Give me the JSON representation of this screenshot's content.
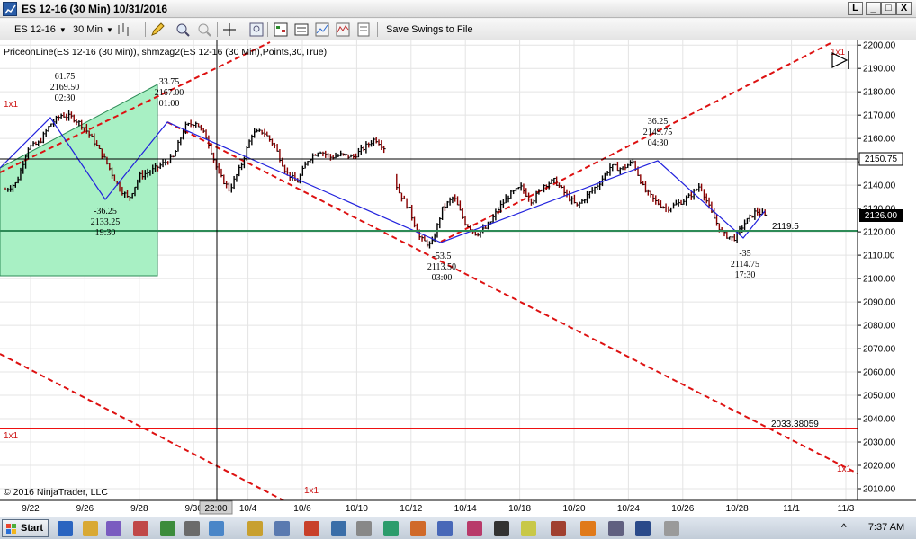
{
  "window": {
    "title": "ES 12-16 (30 Min)  10/31/2016",
    "minimize": "_",
    "maximize": "□",
    "close": "X",
    "restore": "L"
  },
  "toolbar": {
    "instrument": "ES 12-16",
    "interval": "30 Min",
    "save_swings_label": "Save Swings to File",
    "icons": [
      "bars-icon",
      "pencil-icon",
      "zoom-in-icon",
      "zoom-out-icon",
      "crosshair-icon",
      "magnifier-icon",
      "data-box-icon",
      "properties-icon",
      "chart-style-icon",
      "indicators-icon",
      "strategies-icon"
    ]
  },
  "chart": {
    "indicator_label": "PriceonLine(ES 12-16 (30 Min)), shmzag2(ES 12-16 (30 Min),Points,30,True)",
    "copyright": "© 2016 NinjaTrader, LLC",
    "cursor_time_label": "22:00",
    "line_labels": {
      "resistance_price": "2150.75",
      "support_price": "2119.5",
      "horizontal_red_price": "2033.38059",
      "last_price": "2126.00"
    },
    "gann_labels": [
      "1x1",
      "1x1",
      "1x1",
      "1x1",
      "1x1"
    ],
    "colors": {
      "swing_line": "#2222dd",
      "gann_line": "#dd1111",
      "support_line": "#2e8b57",
      "rectangle_fill": "#a8f0c4",
      "up_bar": "#000000"
    }
  },
  "chart_data": {
    "type": "bar",
    "title": "ES 12-16 (30 Min)",
    "ylim": [
      2005,
      2202
    ],
    "y_ticks": [
      "2200.00",
      "2190.00",
      "2180.00",
      "2170.00",
      "2160.00",
      "2150.00",
      "2140.00",
      "2130.00",
      "2120.00",
      "2110.00",
      "2100.00",
      "2090.00",
      "2080.00",
      "2070.00",
      "2060.00",
      "2050.00",
      "2040.00",
      "2030.00",
      "2020.00",
      "2010.00"
    ],
    "x_tick_labels": [
      "9/22",
      "9/26",
      "9/28",
      "9/30",
      "10/4",
      "10/6",
      "10/10",
      "10/12",
      "10/14",
      "10/18",
      "10/20",
      "10/24",
      "10/26",
      "10/28",
      "11/1",
      "11/3"
    ],
    "swing_points": [
      {
        "time": "02:30",
        "price": 2169.5,
        "change": "61.75",
        "type": "high"
      },
      {
        "time": "19:30",
        "price": 2133.25,
        "change": "-36.25",
        "type": "low"
      },
      {
        "time": "01:00",
        "price": 2167.0,
        "change": "33.75",
        "type": "high"
      },
      {
        "time": "03:00",
        "price": 2113.5,
        "change": "-53.5",
        "type": "low"
      },
      {
        "time": "04:30",
        "price": 2149.75,
        "change": "36.25",
        "type": "high"
      },
      {
        "time": "17:30",
        "price": 2114.75,
        "change": "-35",
        "type": "low"
      }
    ],
    "price_path": [
      [
        0,
        2138
      ],
      [
        0.4,
        2141
      ],
      [
        0.8,
        2156
      ],
      [
        1.2,
        2158
      ],
      [
        1.6,
        2166
      ],
      [
        2.0,
        2170
      ],
      [
        2.4,
        2169
      ],
      [
        2.8,
        2165
      ],
      [
        3.2,
        2158
      ],
      [
        3.6,
        2150
      ],
      [
        4.0,
        2140
      ],
      [
        4.4,
        2134
      ],
      [
        4.8,
        2144
      ],
      [
        5.2,
        2146
      ],
      [
        5.6,
        2149
      ],
      [
        6.0,
        2152
      ],
      [
        6.4,
        2165
      ],
      [
        6.8,
        2167
      ],
      [
        7.2,
        2160
      ],
      [
        7.6,
        2145
      ],
      [
        8.0,
        2138
      ],
      [
        8.4,
        2148
      ],
      [
        8.8,
        2162
      ],
      [
        9.2,
        2163
      ],
      [
        9.6,
        2157
      ],
      [
        10.0,
        2146
      ],
      [
        10.4,
        2141
      ],
      [
        10.8,
        2151
      ],
      [
        11.2,
        2155
      ],
      [
        11.6,
        2152
      ],
      [
        12.0,
        2153
      ],
      [
        12.4,
        2152
      ],
      [
        12.8,
        2156
      ],
      [
        13.2,
        2160
      ],
      [
        13.6,
        2155
      ],
      [
        14.0,
        2138
      ],
      [
        14.4,
        2130
      ],
      [
        14.8,
        2117
      ],
      [
        15.2,
        2114
      ],
      [
        15.6,
        2130
      ],
      [
        16.0,
        2135
      ],
      [
        16.4,
        2124
      ],
      [
        16.8,
        2119
      ],
      [
        17.2,
        2122
      ],
      [
        17.6,
        2130
      ],
      [
        18.0,
        2136
      ],
      [
        18.4,
        2139
      ],
      [
        18.8,
        2133
      ],
      [
        19.2,
        2140
      ],
      [
        19.6,
        2142
      ],
      [
        20.0,
        2136
      ],
      [
        20.4,
        2131
      ],
      [
        20.8,
        2136
      ],
      [
        21.2,
        2141
      ],
      [
        21.6,
        2148
      ],
      [
        22.0,
        2147
      ],
      [
        22.4,
        2150
      ],
      [
        22.8,
        2138
      ],
      [
        23.2,
        2133
      ],
      [
        23.6,
        2130
      ],
      [
        24.0,
        2132
      ],
      [
        24.4,
        2135
      ],
      [
        24.8,
        2140
      ],
      [
        25.2,
        2128
      ],
      [
        25.6,
        2119
      ],
      [
        26.0,
        2117
      ],
      [
        26.4,
        2124
      ],
      [
        26.8,
        2129
      ],
      [
        27.2,
        2126
      ]
    ],
    "horizontal_lines": [
      2150.75,
      2119.5,
      2033.38059
    ]
  }
}
